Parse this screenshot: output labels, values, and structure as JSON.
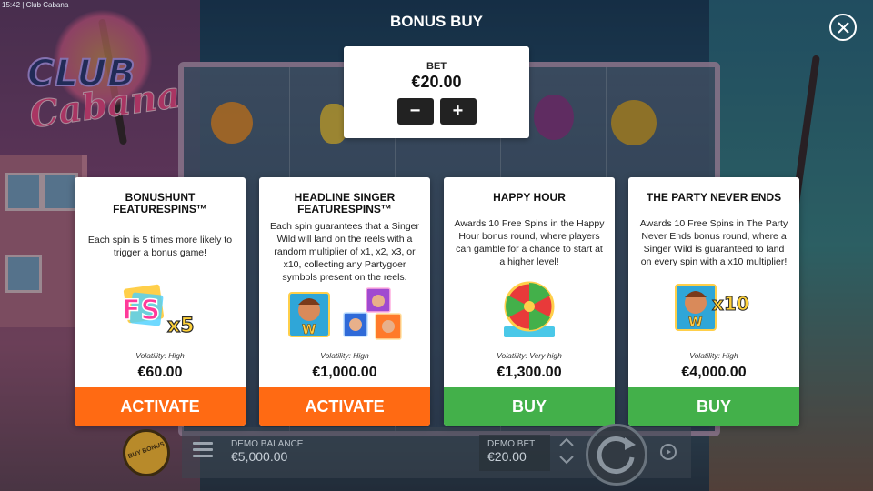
{
  "status_bar": {
    "time": "15:42",
    "app_name": "Club Cabana"
  },
  "header": {
    "title": "BONUS BUY",
    "close_icon": "close-icon"
  },
  "game_logo": {
    "line1": "CLUB",
    "line2": "Cabana"
  },
  "bet": {
    "label": "BET",
    "value": "€20.00",
    "decrease_label": "−",
    "increase_label": "+"
  },
  "cards": [
    {
      "title": "BONUSHUNT FEATURESPINS™",
      "description": "Each spin is 5 times more likely to trigger a bonus game!",
      "art": "fs-x5-badge",
      "art_text_main": "FS",
      "art_text_mult": "x5",
      "volatility": "Volatility: High",
      "price": "€60.00",
      "action": "ACTIVATE",
      "action_color": "#ff6a13"
    },
    {
      "title": "HEADLINE SINGER FEATURESPINS™",
      "description": "Each spin guarantees that a Singer Wild will land on the reels with a random multiplier of x1, x2, x3, or x10, collecting any Partygoer symbols present on the reels.",
      "art": "singer-and-partygoers",
      "art_wild_letter": "W",
      "volatility": "Volatility: High",
      "price": "€1,000.00",
      "action": "ACTIVATE",
      "action_color": "#ff6a13"
    },
    {
      "title": "HAPPY HOUR",
      "description": "Awards 10 Free Spins in the Happy Hour bonus round, where players can gamble for a chance to start at a higher level!",
      "art": "prize-wheel",
      "volatility": "Volatility: Very high",
      "price": "€1,300.00",
      "action": "BUY",
      "action_color": "#43b04a"
    },
    {
      "title": "THE PARTY NEVER ENDS",
      "description": "Awards 10 Free Spins in The Party Never Ends bonus round, where a Singer Wild is guaranteed to land on every spin with a x10 multiplier!",
      "art": "singer-wild-x10",
      "art_wild_letter": "W",
      "art_text_mult": "x10",
      "volatility": "Volatility: High",
      "price": "€4,000.00",
      "action": "BUY",
      "action_color": "#43b04a"
    }
  ],
  "bottom_bar": {
    "buy_bonus_label": "BUY BONUS",
    "balance_label": "DEMO BALANCE",
    "balance_value": "€5,000.00",
    "bet_label": "DEMO BET",
    "bet_value": "€20.00"
  }
}
